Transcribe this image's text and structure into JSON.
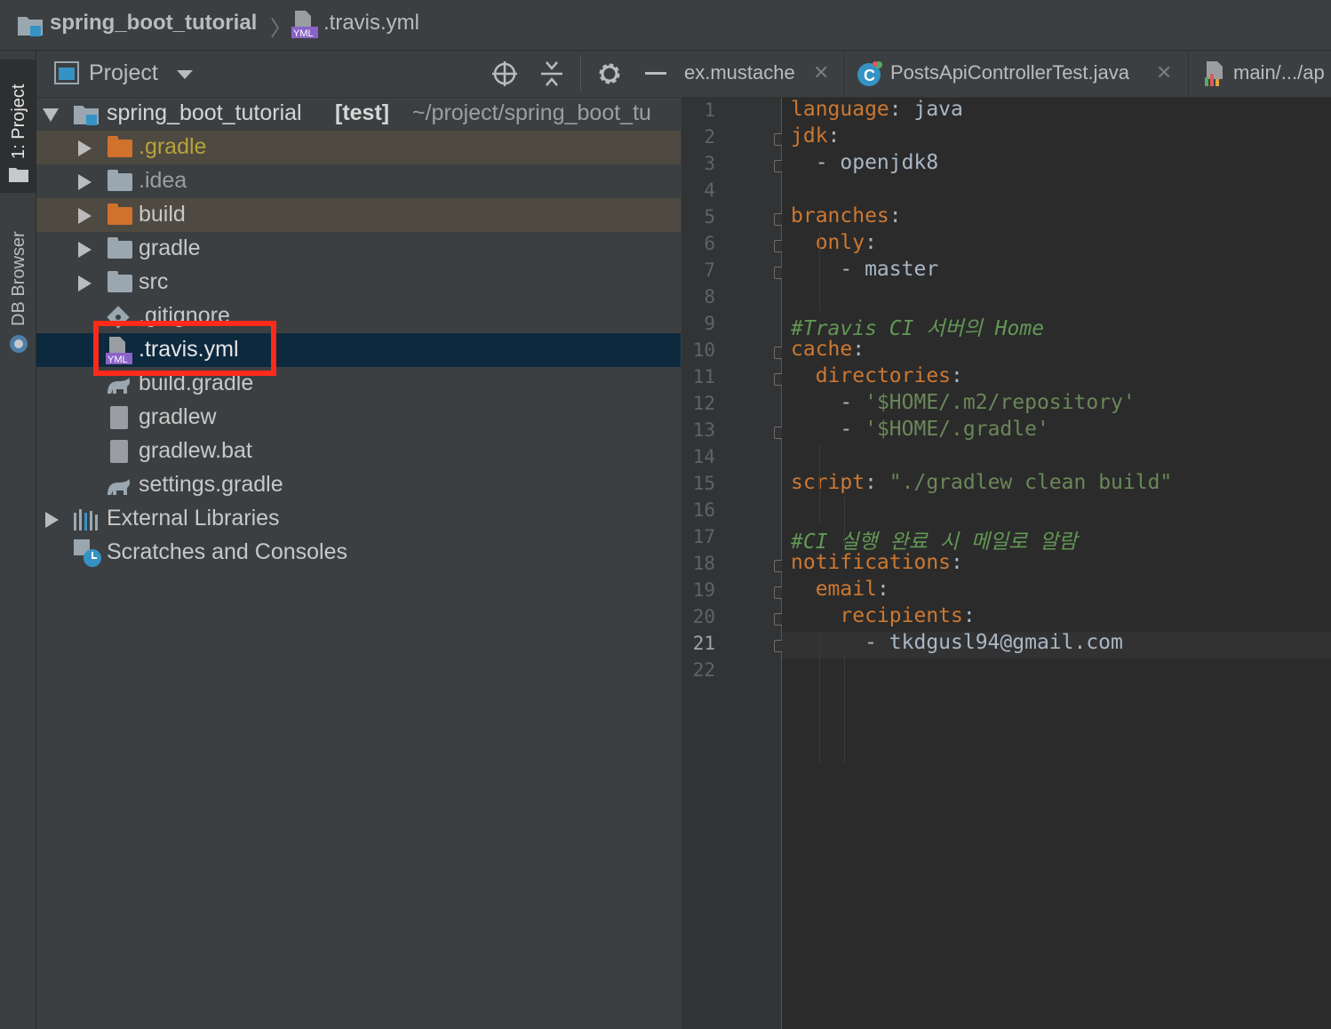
{
  "breadcrumb": {
    "project": "spring_boot_tutorial",
    "separator": "〉",
    "file": ".travis.yml"
  },
  "left_strip": {
    "project_tab": "1: Project",
    "db_browser_tab": "DB Browser"
  },
  "project_panel": {
    "title": "Project",
    "icons": [
      "locate-icon",
      "collapse-icon",
      "gear-icon",
      "minimize-icon"
    ],
    "root": {
      "name": "spring_boot_tutorial",
      "module": "[test]",
      "path": "~/project/spring_boot_tu"
    },
    "items": [
      {
        "name": ".gradle",
        "type": "folder-orange"
      },
      {
        "name": ".idea",
        "type": "folder"
      },
      {
        "name": "build",
        "type": "folder-orange"
      },
      {
        "name": "gradle",
        "type": "folder"
      },
      {
        "name": "src",
        "type": "folder"
      },
      {
        "name": ".gitignore",
        "type": "git-file"
      },
      {
        "name": ".travis.yml",
        "type": "yml-file"
      },
      {
        "name": "build.gradle",
        "type": "gradle-file"
      },
      {
        "name": "gradlew",
        "type": "file"
      },
      {
        "name": "gradlew.bat",
        "type": "file"
      },
      {
        "name": "settings.gradle",
        "type": "gradle-file"
      }
    ],
    "external_libraries": "External Libraries",
    "scratches": "Scratches and Consoles",
    "highlight_color": "#ff2a1a"
  },
  "tabs": [
    {
      "label": "ex.mustache",
      "close": "✕"
    },
    {
      "label": "PostsApiControllerTest.java",
      "close": "✕"
    },
    {
      "label": "main/.../ap",
      "close": ""
    }
  ],
  "editor": {
    "current_line": 21,
    "lines": [
      {
        "n": "1",
        "parts": [
          [
            "k",
            "language"
          ],
          [
            "p",
            ": java"
          ]
        ]
      },
      {
        "n": "2",
        "parts": [
          [
            "k",
            "jdk"
          ],
          [
            "p",
            ":"
          ]
        ]
      },
      {
        "n": "3",
        "parts": [
          [
            "p",
            "  - openjdk8"
          ]
        ]
      },
      {
        "n": "4",
        "parts": []
      },
      {
        "n": "5",
        "parts": [
          [
            "k",
            "branches"
          ],
          [
            "p",
            ":"
          ]
        ]
      },
      {
        "n": "6",
        "parts": [
          [
            "p",
            "  "
          ],
          [
            "k",
            "only"
          ],
          [
            "p",
            ":"
          ]
        ]
      },
      {
        "n": "7",
        "parts": [
          [
            "p",
            "    - master"
          ]
        ]
      },
      {
        "n": "8",
        "parts": []
      },
      {
        "n": "9",
        "parts": [
          [
            "c",
            "#Travis CI 서버의 Home"
          ]
        ]
      },
      {
        "n": "10",
        "parts": [
          [
            "k",
            "cache"
          ],
          [
            "p",
            ":"
          ]
        ]
      },
      {
        "n": "11",
        "parts": [
          [
            "p",
            "  "
          ],
          [
            "k",
            "directories"
          ],
          [
            "p",
            ":"
          ]
        ]
      },
      {
        "n": "12",
        "parts": [
          [
            "p",
            "    - "
          ],
          [
            "s",
            "'$HOME/.m2/repository'"
          ]
        ]
      },
      {
        "n": "13",
        "parts": [
          [
            "p",
            "    - "
          ],
          [
            "s",
            "'$HOME/.gradle'"
          ]
        ]
      },
      {
        "n": "14",
        "parts": []
      },
      {
        "n": "15",
        "parts": [
          [
            "k",
            "script"
          ],
          [
            "p",
            ": "
          ],
          [
            "s",
            "\"./gradlew clean build\""
          ]
        ]
      },
      {
        "n": "16",
        "parts": []
      },
      {
        "n": "17",
        "parts": [
          [
            "c",
            "#CI 실행 완료 시 메일로 알람"
          ]
        ]
      },
      {
        "n": "18",
        "parts": [
          [
            "k",
            "notifications"
          ],
          [
            "p",
            ":"
          ]
        ]
      },
      {
        "n": "19",
        "parts": [
          [
            "p",
            "  "
          ],
          [
            "k",
            "email"
          ],
          [
            "p",
            ":"
          ]
        ]
      },
      {
        "n": "20",
        "parts": [
          [
            "p",
            "    "
          ],
          [
            "k",
            "recipients"
          ],
          [
            "p",
            ":"
          ]
        ]
      },
      {
        "n": "21",
        "parts": [
          [
            "p",
            "      - tkdgusl94@gmail.com"
          ]
        ]
      },
      {
        "n": "22",
        "parts": []
      }
    ]
  }
}
